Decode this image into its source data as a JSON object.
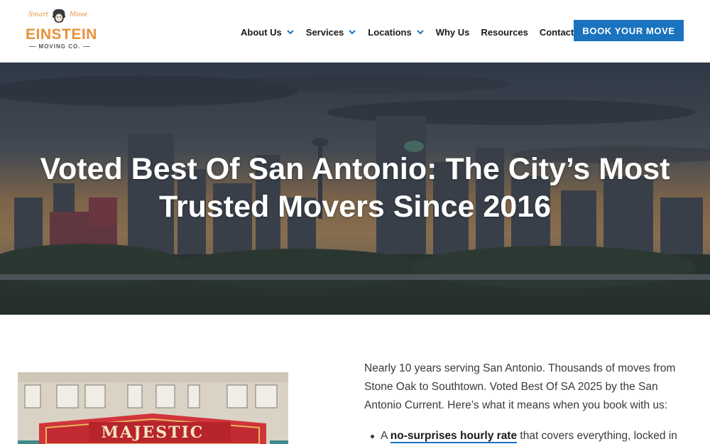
{
  "header": {
    "logo": {
      "tag_left": "Smart",
      "tag_right": "Move",
      "brand": "EINSTEIN",
      "sub": "MOVING CO.",
      "color": "#e8913a"
    },
    "nav": [
      {
        "label": "About Us",
        "has_dropdown": true
      },
      {
        "label": "Services",
        "has_dropdown": true
      },
      {
        "label": "Locations",
        "has_dropdown": true
      },
      {
        "label": "Why Us",
        "has_dropdown": false
      },
      {
        "label": "Resources",
        "has_dropdown": false
      },
      {
        "label": "Contact",
        "has_dropdown": false
      }
    ],
    "cta_label": "BOOK YOUR MOVE",
    "accent": "#1a73be"
  },
  "hero": {
    "title": "Voted Best Of San Antonio: The City’s Most Trusted Movers Since 2016",
    "background": "san-antonio-skyline-dusk"
  },
  "content": {
    "photo": {
      "sign_text": "MAJESTIC"
    },
    "intro": "Nearly 10 years serving San Antonio. Thousands of moves from Stone Oak to Southtown. Voted Best Of SA 2025 by the San Antonio Current. Here’s what it means when you book with us:",
    "bullets": [
      {
        "prefix": "A ",
        "link": "no-surprises hourly rate",
        "suffix": " that covers everything, locked in"
      }
    ]
  }
}
